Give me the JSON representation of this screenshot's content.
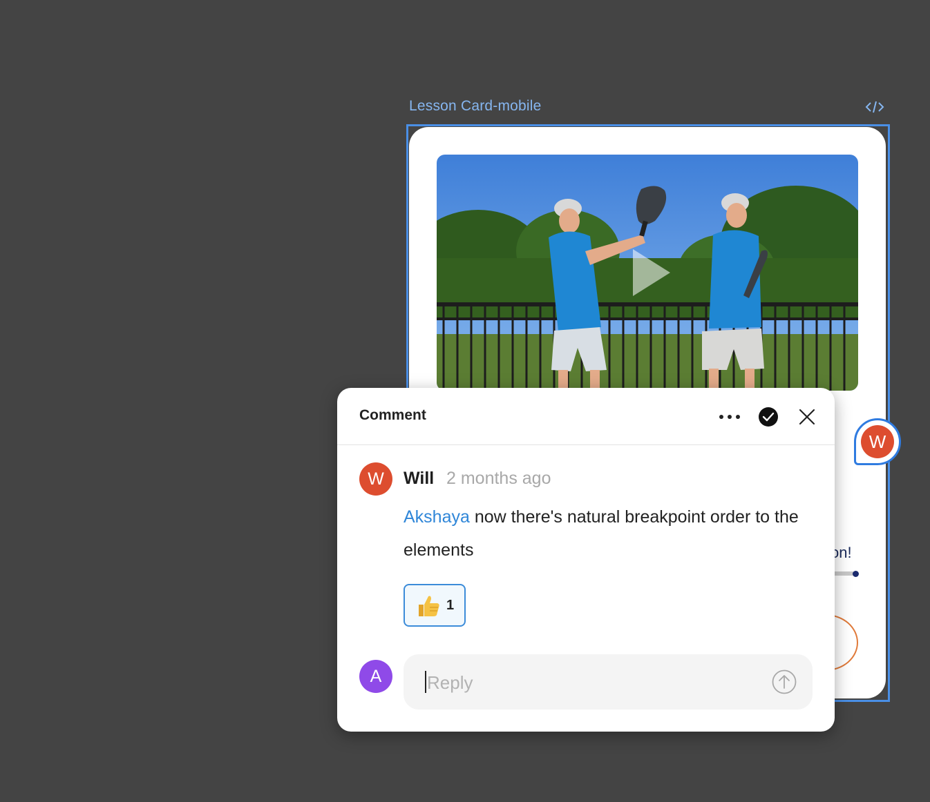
{
  "frame": {
    "label": "Lesson Card-mobile",
    "code_icon": "code-brackets-icon"
  },
  "lesson_card": {
    "video_play_icon": "play-icon",
    "text_fragment": "on!"
  },
  "pin": {
    "avatar_initial": "W"
  },
  "comment": {
    "title": "Comment",
    "more_icon": "ellipsis-icon",
    "resolve_icon": "checkmark-circle-icon",
    "close_icon": "close-icon",
    "author": {
      "initial": "W",
      "name": "Will",
      "timestamp": "2 months ago"
    },
    "message": {
      "mention": "Akshaya",
      "text": " now there's natural breakpoint order to the elements"
    },
    "reaction": {
      "emoji": "thumbs-up-icon",
      "count": "1"
    },
    "reply": {
      "avatar_initial": "A",
      "placeholder": "Reply",
      "value": "",
      "send_icon": "send-arrow-icon"
    }
  },
  "colors": {
    "canvas": "#444444",
    "selection": "#4a8fe6",
    "author_avatar": "#dd4d2f",
    "reply_avatar": "#8f4ae8",
    "mention": "#2f86d8"
  }
}
